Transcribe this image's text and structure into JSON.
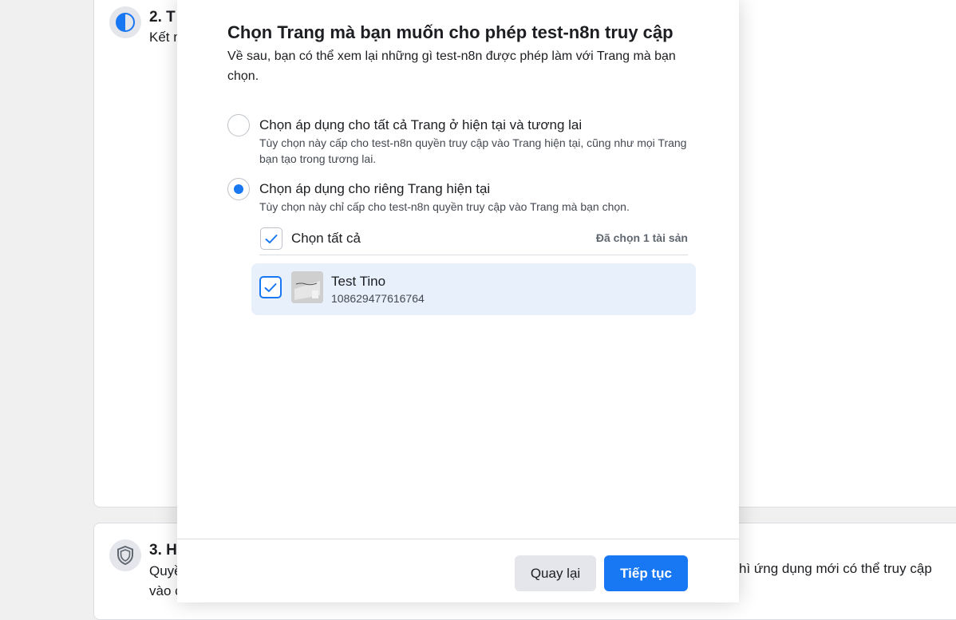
{
  "background": {
    "step2": {
      "title": "2. T",
      "subtitle": "Kết n"
    },
    "step3": {
      "title": "3. H",
      "subtitle_line1": "Quyề",
      "subtitle_line2": "vào c",
      "right_text": "hì ứng dụng mới có thể truy cập"
    }
  },
  "modal": {
    "title": "Chọn Trang mà bạn muốn cho phép test-n8n truy cập",
    "description": "Về sau, bạn có thể xem lại những gì test-n8n được phép làm với Trang mà bạn chọn.",
    "options": [
      {
        "label": "Chọn áp dụng cho tất cả Trang ở hiện tại và tương lai",
        "description": "Tùy chọn này cấp cho test-n8n quyền truy cập vào Trang hiện tại, cũng như mọi Trang bạn tạo trong tương lai.",
        "selected": false
      },
      {
        "label": "Chọn áp dụng cho riêng Trang hiện tại",
        "description": "Tùy chọn này chỉ cấp cho test-n8n quyền truy cập vào Trang mà bạn chọn.",
        "selected": true
      }
    ],
    "select_all_label": "Chọn tất cả",
    "selected_count": "Đã chọn 1 tài sản",
    "assets": [
      {
        "name": "Test Tino",
        "id": "108629477616764",
        "checked": true
      }
    ],
    "buttons": {
      "back": "Quay lại",
      "next": "Tiếp tục"
    }
  },
  "colors": {
    "accent": "#1877f2",
    "selected_row": "#e7f0fb",
    "secondary_button": "#e4e6eb"
  }
}
